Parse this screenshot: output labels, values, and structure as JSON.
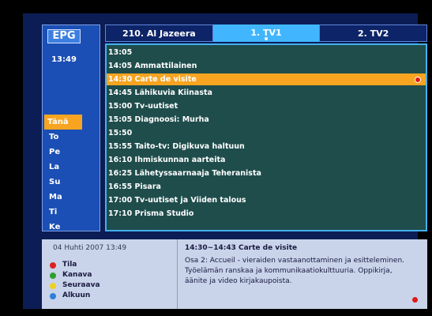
{
  "header": {
    "epg_label": "EPG",
    "clock": "13:49"
  },
  "days": [
    "Tänä",
    "To",
    "Pe",
    "La",
    "Su",
    "Ma",
    "Ti",
    "Ke"
  ],
  "active_day_index": 0,
  "tabs": [
    {
      "label": "210. Al Jazeera"
    },
    {
      "label": "1. TV1"
    },
    {
      "label": "2. TV2"
    }
  ],
  "active_tab_index": 1,
  "programmes": [
    "13:05",
    "14:05 Ammattilainen",
    "14:30 Carte de visite",
    "14:45 Lähikuvia Kiinasta",
    "15:00 Tv-uutiset",
    "15:05 Diagnoosi: Murha",
    "15:50",
    "15:55 Taito-tv: Digikuva haltuun",
    "16:10 Ihmiskunnan aarteita",
    "16:25 Lähetyssaarnaaja Teheranista",
    "16:55 Pisara",
    "17:00 Tv-uutiset ja Viiden talous",
    "17:10 Prisma Studio"
  ],
  "selected_programme_index": 2,
  "info": {
    "datetime": "04 Huhti 2007 13:49",
    "program_time": "14:30~14:43 Carte de visite",
    "description": "Osa 2: Accueil - vieraiden vastaanottaminen ja esitteleminen. Työelämän ranskaa ja kommunikaatiokulttuuria. Oppikirja, äänite ja video kirjakaupoista."
  },
  "legend": [
    {
      "label": "Tila",
      "color": "#e02020"
    },
    {
      "label": "Kanava",
      "color": "#2ea02e"
    },
    {
      "label": "Seuraava",
      "color": "#f0d020"
    },
    {
      "label": "Alkuun",
      "color": "#2f80d8"
    }
  ],
  "colors": {
    "selection": "#f7a420",
    "active_tab": "#41b6ff",
    "list_bg": "#1f4d4c",
    "record": "#e01818"
  }
}
